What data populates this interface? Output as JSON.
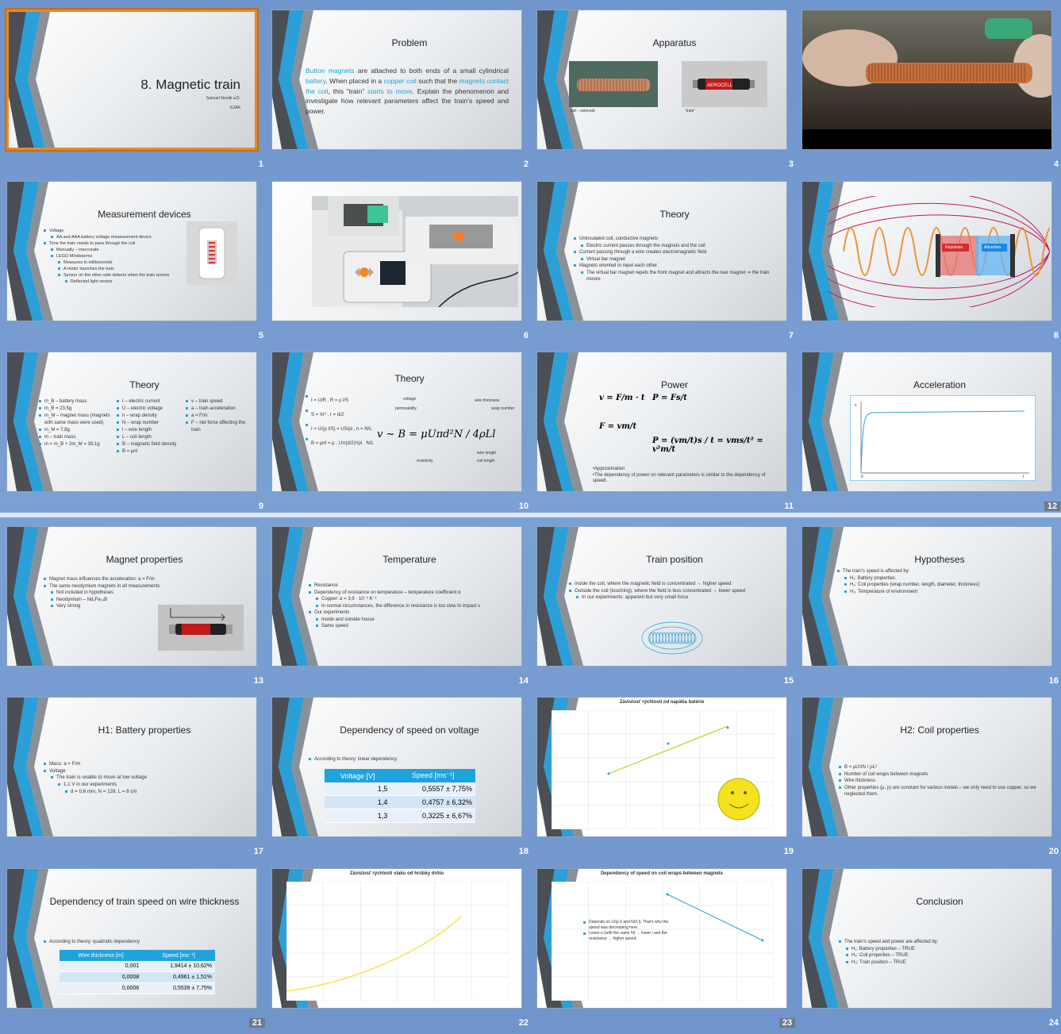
{
  "slides": [
    {
      "num": "1",
      "title": "8. Magnetic train",
      "author": "Samuel Novák a.D.",
      "school": "GJAR"
    },
    {
      "num": "2",
      "title": "Problem",
      "body": [
        {
          "t": "Button magnets",
          "hl": true
        },
        {
          "t": " are attached to both ends of a small cylindrical ",
          "hl": false
        },
        {
          "t": "battery",
          "hl": true
        },
        {
          "t": ". When placed in a ",
          "hl": false
        },
        {
          "t": "copper coil",
          "hl": true
        },
        {
          "t": " such that the ",
          "hl": false
        },
        {
          "t": "magnets contact the coil",
          "hl": true
        },
        {
          "t": ", this “train” ",
          "hl": false
        },
        {
          "t": "starts to move",
          "hl": true
        },
        {
          "t": ". Explain the phenomenon and investigate how relevant parameters affect the train’s speed and power.",
          "hl": false
        }
      ]
    },
    {
      "num": "3",
      "title": "Apparatus",
      "cap1": "coil - solenoid",
      "cap2": "“train”"
    },
    {
      "num": "4"
    },
    {
      "num": "5",
      "title": "Measurement devices",
      "items": [
        {
          "l": 1,
          "t": "Voltage"
        },
        {
          "l": 2,
          "t": "AA and AAA battery voltage measurement device"
        },
        {
          "l": 1,
          "t": "Time the train needs to pass through the coil"
        },
        {
          "l": 2,
          "t": "Manually – inaccurate"
        },
        {
          "l": 2,
          "t": "LEGO Mindstorms"
        },
        {
          "l": 3,
          "t": "Measures in milliseconds"
        },
        {
          "l": 3,
          "t": "A motor launches the train"
        },
        {
          "l": 3,
          "t": "Sensor on the other side detects when the train arrives"
        },
        {
          "l": 4,
          "t": "Reflected light sensor"
        }
      ]
    },
    {
      "num": "6"
    },
    {
      "num": "7",
      "title": "Theory",
      "items": [
        {
          "l": 1,
          "t": "Uninsulated coil, conductive magnets"
        },
        {
          "l": 2,
          "t": "Electric current passes through the magnets and the coil"
        },
        {
          "l": 1,
          "t": "Current passing through a wire creates electromagnetic field"
        },
        {
          "l": 2,
          "t": "Virtual bar magnet"
        },
        {
          "l": 1,
          "t": "Magnets oriented to repel each other"
        },
        {
          "l": 2,
          "t": "The virtual bar magnet repels the front magnet and attracts the rear magnet ⇒ the train moves"
        }
      ]
    },
    {
      "num": "8",
      "rep": "Repulsion",
      "att": "Attraction"
    },
    {
      "num": "9",
      "title": "Theory",
      "col1": [
        "m_B – battery mass",
        "m_B = 23,5g",
        "m_M – magnet mass (magnets with same mass were used)",
        "m_M = 7,8g",
        "m – train mass",
        "m = m_B + 2m_M = 39,1g"
      ],
      "col2": [
        "I – electric current",
        "U – electric voltage",
        "n – wrap density",
        "N – wrap number",
        "l – wire length",
        "L – coil length",
        "B – magnetic field density",
        "B = μnI"
      ],
      "col3": [
        "v – train speed",
        "a – train acceleration",
        "a = F/m",
        "F – net force affecting the train"
      ]
    },
    {
      "num": "10",
      "title": "Theory",
      "main": "v ~ B = μUπd²N / 4ρLl",
      "lbl": [
        "voltage",
        "permeability",
        "wire thickness",
        "wrap number",
        "wire length",
        "coil length",
        "resistivity"
      ],
      "eqs": [
        "I = U/R , R = ρ l/S",
        "S = πr² , r = d/2",
        "I = U/(ρ l/S) = US/ρl , n = N/L",
        "B = μnI = μ · Uπ(d/2)²/ρl · N/L"
      ]
    },
    {
      "num": "11",
      "title": "Power",
      "eq1": "v = F/m · t",
      "eq2": "P = Fs/t",
      "eq3": "F = vm/t",
      "eq4": "P = (vm/t)s / t = vms/t² = v²m/t",
      "note1": "•Approximation",
      "note2": "•The dependency of power on relevant parameters is similar to the dependency of speed."
    },
    {
      "num": "12",
      "title": "Acceleration",
      "ax_v": "v",
      "ax_t": "t",
      "ax_0": "0"
    },
    {
      "num": "13",
      "title": "Magnet properties",
      "items": [
        {
          "l": 1,
          "t": "Magnet mass influences the acceleration: a = F/m"
        },
        {
          "l": 1,
          "t": "The same neodymium magnets in all measurements"
        },
        {
          "l": 2,
          "t": "Not included in hypotheses"
        },
        {
          "l": 2,
          "t": "Neodymium – Nd₂Fe₁₄B"
        },
        {
          "l": 2,
          "t": "Very strong"
        }
      ]
    },
    {
      "num": "14",
      "title": "Temperature",
      "items": [
        {
          "l": 1,
          "t": "Resistance"
        },
        {
          "l": 1,
          "t": "Dependency of resistance on temperature – temperature coefficient α"
        },
        {
          "l": 2,
          "t": "Copper: α = 3,9 · 10⁻³ K⁻¹"
        },
        {
          "l": 2,
          "t": "In normal circumstances, the difference in resistance is too slow to impact v"
        },
        {
          "l": 1,
          "t": "Our experiments"
        },
        {
          "l": 2,
          "t": "Inside and outside house"
        },
        {
          "l": 2,
          "t": "Same speed"
        }
      ]
    },
    {
      "num": "15",
      "title": "Train position",
      "items": [
        {
          "l": 1,
          "t": "Inside the coil, where the magnetic field is concentrated → higher speed"
        },
        {
          "l": 1,
          "t": "Outside the coil (touching), where the field is less concentrated → lower speed"
        },
        {
          "l": 2,
          "t": "In our experiments: apparent but very small force"
        }
      ]
    },
    {
      "num": "16",
      "title": "Hypotheses",
      "items": [
        {
          "l": 1,
          "t": "The train's speed is affected by:"
        },
        {
          "l": 2,
          "t": "H₁: Battery properties"
        },
        {
          "l": 2,
          "t": "H₂: Coil properties (wrap number, length, diameter, thickness)"
        },
        {
          "l": 2,
          "t": "H₃: Temperature of environment"
        }
      ]
    },
    {
      "num": "17",
      "title": "H1: Battery properties",
      "items": [
        {
          "l": 1,
          "t": "Mass: a = F/m"
        },
        {
          "l": 1,
          "t": "Voltage"
        },
        {
          "l": 2,
          "t": "The train is unable to move at low voltage"
        },
        {
          "l": 3,
          "t": "1,1 V in our experiments"
        },
        {
          "l": 4,
          "t": "d = 0,6 mm, N = 128, L = 8 cm"
        }
      ]
    },
    {
      "num": "18",
      "title": "Dependency of speed on voltage",
      "bullet": "According to theory: linear dependency",
      "th": [
        "Voltage [V]",
        "Speed [ms⁻¹]"
      ],
      "rows": [
        [
          "1,5",
          "0,5557 ± 7,75%"
        ],
        [
          "1,4",
          "0,4757 ± 6,32%"
        ],
        [
          "1,3",
          "0,3225 ± 6,67%"
        ]
      ]
    },
    {
      "num": "19",
      "chart_title": "Závislosť rýchlosti od napätia batérie"
    },
    {
      "num": "20",
      "title": "H2: Coil properties",
      "items": [
        {
          "l": 1,
          "t": "B = μUπN / ρL²"
        },
        {
          "l": 1,
          "t": "Number of coil wraps between magnets"
        },
        {
          "l": 1,
          "t": "Wire thickness"
        },
        {
          "l": 1,
          "t": "Other properties (μ, ρ) are constant for various metals – we only need to use copper, so we neglected them."
        }
      ]
    },
    {
      "num": "21",
      "title": "Dependency of train speed on wire thickness",
      "bullet": "According to theory: quadratic dependency",
      "th": [
        "Wire thickness [m]",
        "Speed [ms⁻¹]"
      ],
      "rows": [
        [
          "0,001",
          "1,9414 ± 10,62%"
        ],
        [
          "0,0008",
          "0,4961 ± 1,51%"
        ],
        [
          "0,0006",
          "0,5539 ± 7,75%"
        ]
      ]
    },
    {
      "num": "22",
      "chart_title": "Závislosť rýchlosti vlaku od hrúbky drôtu"
    },
    {
      "num": "23",
      "chart_title": "Dependency of speed on coil wraps between magnets",
      "notes": [
        "Depends on U/(ρ l) and N/(l·l). That's why the speed was decreasing here.",
        "Lower n (with the same N) → lower l and the resistance → higher speed"
      ]
    },
    {
      "num": "24",
      "title": "Conclusion",
      "items": [
        {
          "l": 1,
          "t": "The train's speed and power are affected by:"
        },
        {
          "l": 2,
          "t": "H₁: Battery properties – TRUE"
        },
        {
          "l": 2,
          "t": "H₂: Coil properties – TRUE"
        },
        {
          "l": 2,
          "t": "H₃: Train position – TRUE"
        }
      ]
    }
  ],
  "colors": {
    "accent": "#1fa3dc",
    "selected_border": "#e58a2b",
    "background": "#7aa0d4"
  }
}
